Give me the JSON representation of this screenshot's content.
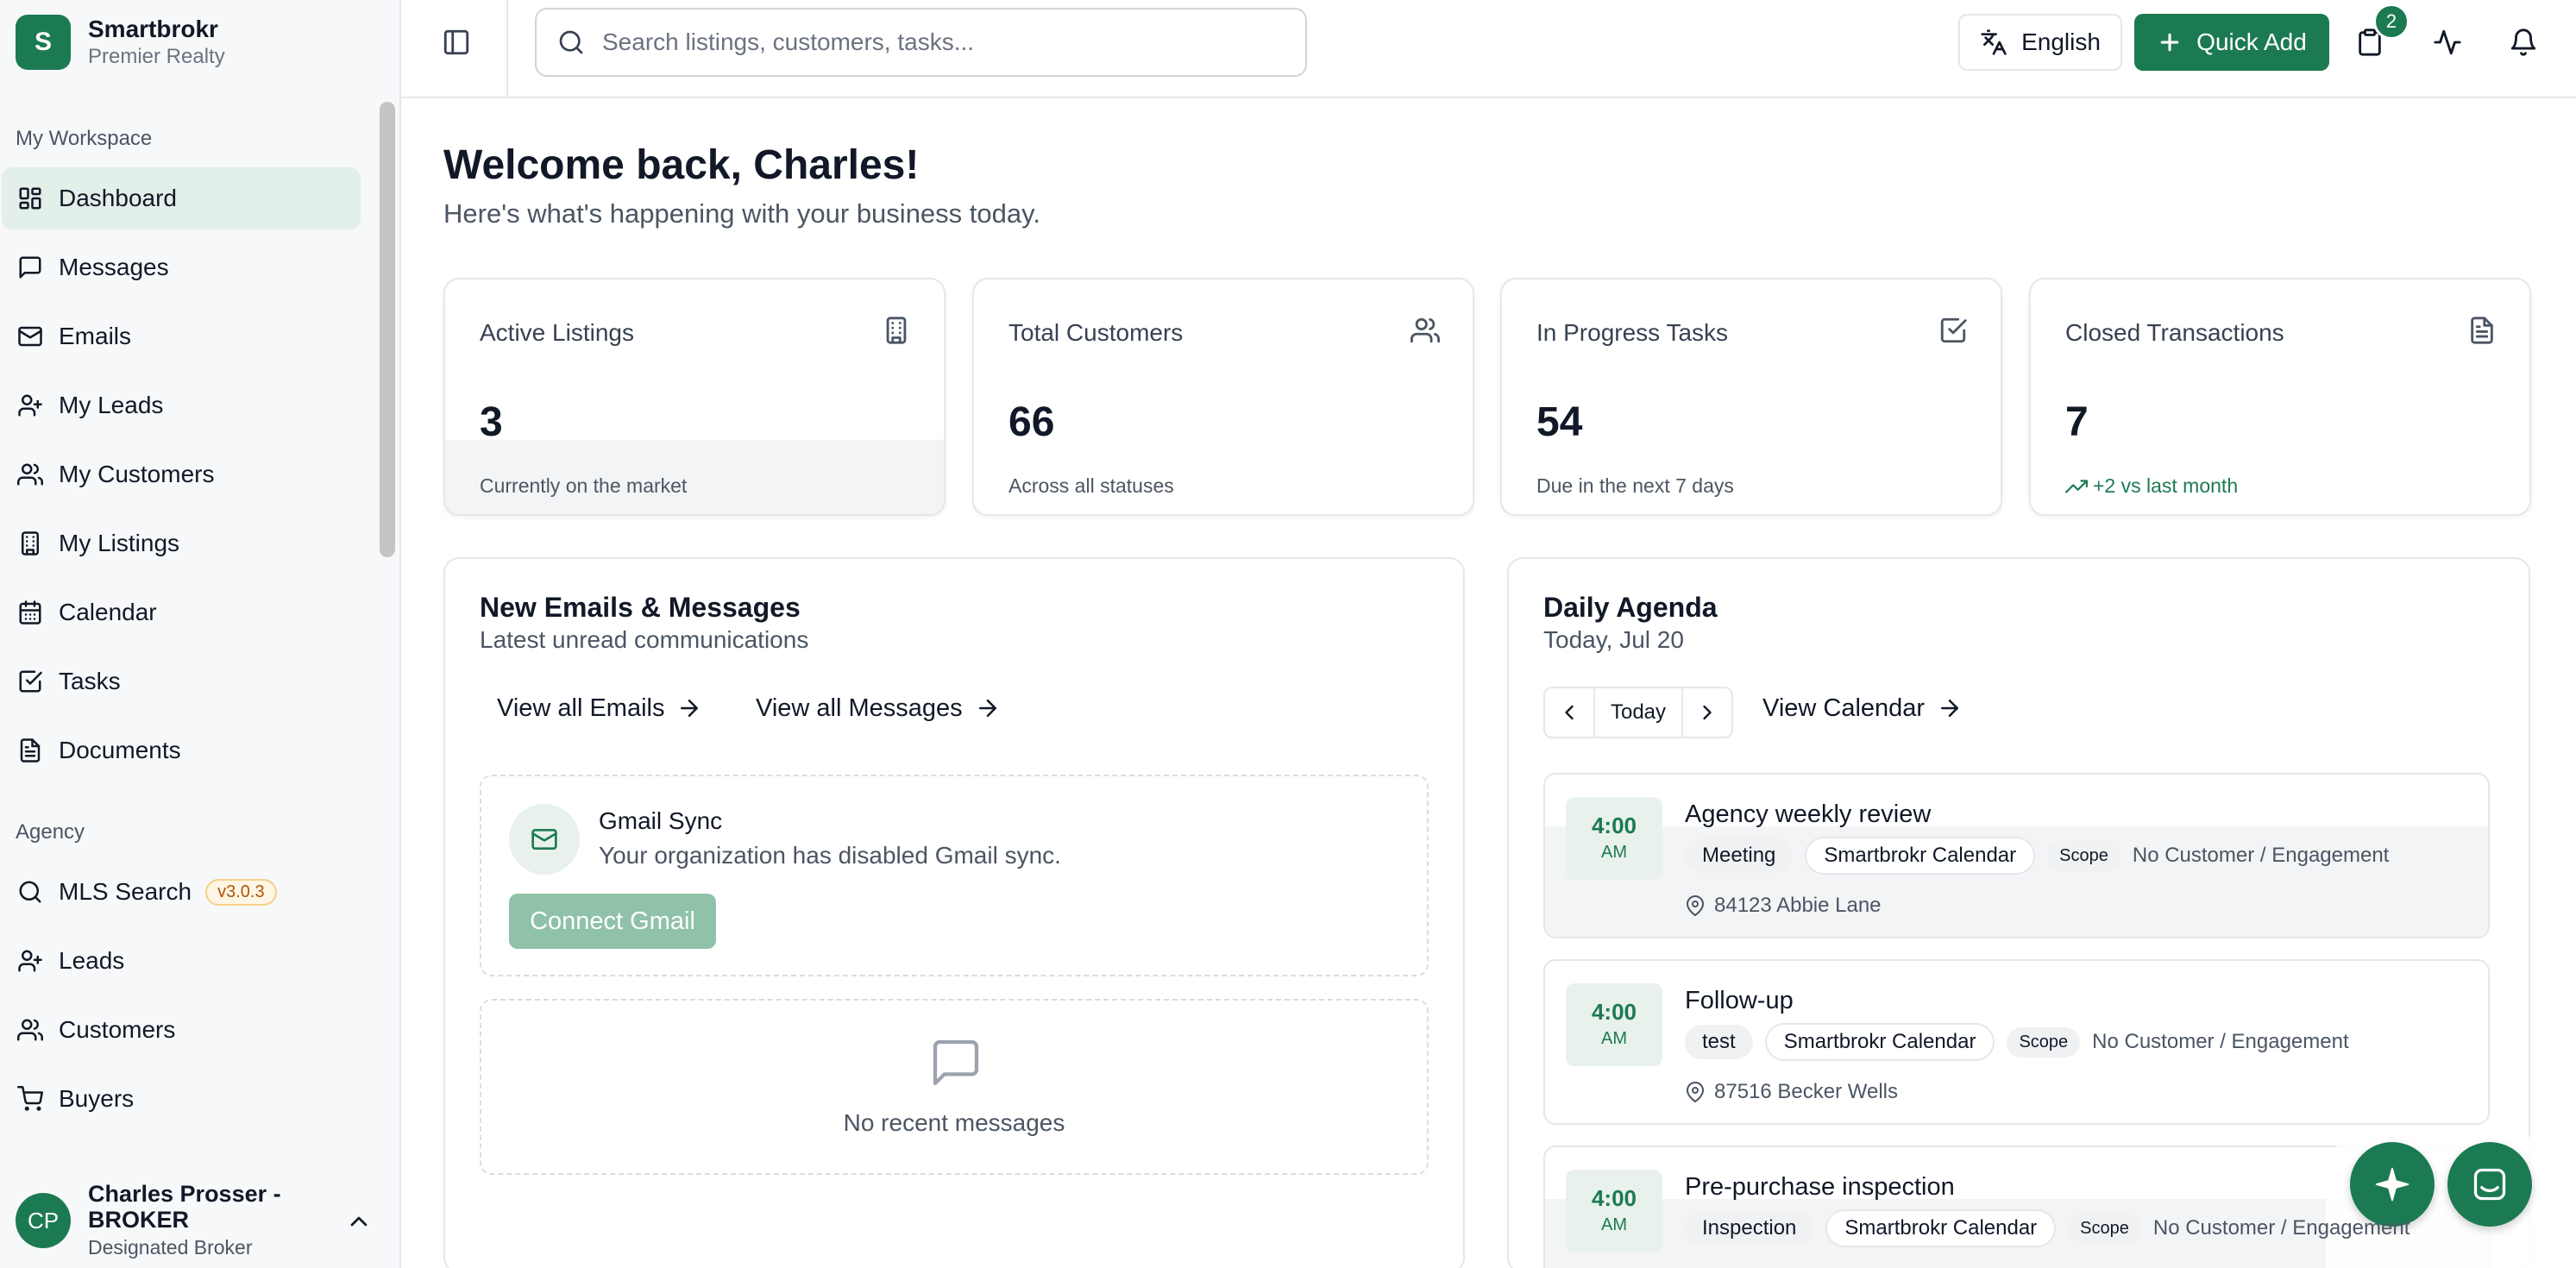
{
  "brand": {
    "initial": "S",
    "name": "Smartbrokr",
    "org": "Premier Realty"
  },
  "sidebar": {
    "workspace_label": "My Workspace",
    "workspace_items": [
      {
        "label": "Dashboard",
        "icon": "dashboard-icon",
        "active": true
      },
      {
        "label": "Messages",
        "icon": "message-icon"
      },
      {
        "label": "Emails",
        "icon": "mail-icon"
      },
      {
        "label": "My Leads",
        "icon": "user-plus-icon"
      },
      {
        "label": "My Customers",
        "icon": "users-icon"
      },
      {
        "label": "My Listings",
        "icon": "building-icon"
      },
      {
        "label": "Calendar",
        "icon": "calendar-icon"
      },
      {
        "label": "Tasks",
        "icon": "checkbox-icon"
      },
      {
        "label": "Documents",
        "icon": "document-icon"
      }
    ],
    "agency_label": "Agency",
    "agency_items": [
      {
        "label": "MLS Search",
        "icon": "search-icon",
        "badge": "v3.0.3"
      },
      {
        "label": "Leads",
        "icon": "user-plus-icon"
      },
      {
        "label": "Customers",
        "icon": "users-icon"
      },
      {
        "label": "Buyers",
        "icon": "cart-icon"
      }
    ]
  },
  "user": {
    "initials": "CP",
    "name": "Charles Prosser - BROKER",
    "role": "Designated Broker"
  },
  "header": {
    "search_placeholder": "Search listings, customers, tasks...",
    "language": "English",
    "quick_add": "Quick Add",
    "notification_count": "2"
  },
  "welcome": {
    "title": "Welcome back, Charles!",
    "subtitle": "Here's what's happening with your business today."
  },
  "stats": [
    {
      "title": "Active Listings",
      "value": "3",
      "note": "Currently on the market",
      "icon": "building-icon"
    },
    {
      "title": "Total Customers",
      "value": "66",
      "note": "Across all statuses",
      "icon": "users-icon"
    },
    {
      "title": "In Progress Tasks",
      "value": "54",
      "note": "Due in the next 7 days",
      "icon": "checkbox-icon"
    },
    {
      "title": "Closed Transactions",
      "value": "7",
      "note": "+2 vs last month",
      "icon": "document-icon"
    }
  ],
  "messages_panel": {
    "title": "New Emails & Messages",
    "subtitle": "Latest unread communications",
    "view_emails": "View all Emails",
    "view_messages": "View all Messages",
    "gmail_title": "Gmail Sync",
    "gmail_desc": "Your organization has disabled Gmail sync.",
    "connect": "Connect Gmail",
    "empty": "No recent messages"
  },
  "agenda": {
    "title": "Daily Agenda",
    "date": "Today, Jul 20",
    "today": "Today",
    "view_calendar": "View Calendar",
    "events": [
      {
        "time": "4:00",
        "ampm": "AM",
        "title": "Agency weekly review",
        "type": "Meeting",
        "calendar": "Smartbrokr Calendar",
        "scope_label": "Scope",
        "scope": "No Customer / Engagement",
        "location": "84123 Abbie Lane"
      },
      {
        "time": "4:00",
        "ampm": "AM",
        "title": "Follow-up",
        "type": "test",
        "calendar": "Smartbrokr Calendar",
        "scope_label": "Scope",
        "scope": "No Customer / Engagement",
        "location": "87516 Becker Wells"
      },
      {
        "time": "4:00",
        "ampm": "AM",
        "title": "Pre-purchase inspection",
        "type": "Inspection",
        "calendar": "Smartbrokr Calendar",
        "scope_label": "Scope",
        "scope": "No Customer / Engagement",
        "location": ""
      }
    ]
  },
  "colors": {
    "brand": "#1c7a52",
    "active_nav": "#e3efe9"
  }
}
